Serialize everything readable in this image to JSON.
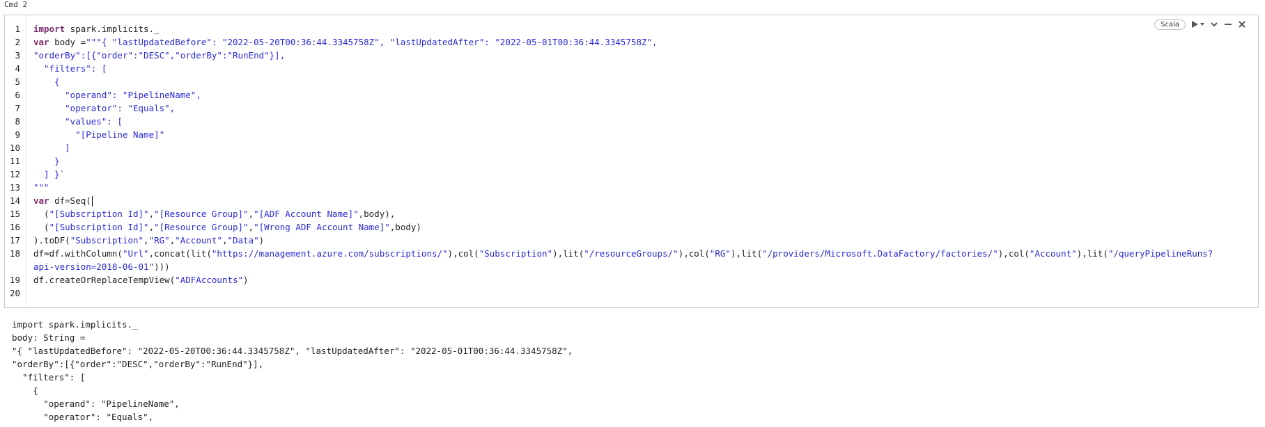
{
  "cmd_label": "Cmd 2",
  "toolbar": {
    "language": "Scala",
    "run_icon": "play-icon",
    "run_menu_icon": "caret-down-icon",
    "collapse_icon": "chevron-down-icon",
    "minimize_icon": "minus-icon",
    "close_icon": "close-icon"
  },
  "line_numbers": [
    "1",
    "2",
    "3",
    "4",
    "5",
    "6",
    "7",
    "8",
    "9",
    "10",
    "11",
    "12",
    "13",
    "14",
    "15",
    "16",
    "17",
    "18",
    "",
    "19",
    "20"
  ],
  "output_lines": [
    "import spark.implicits._",
    "body: String =",
    "\"{ \"lastUpdatedBefore\": \"2022-05-20T00:36:44.3345758Z\", \"lastUpdatedAfter\": \"2022-05-01T00:36:44.3345758Z\",",
    "\"orderBy\":[{\"order\":\"DESC\",\"orderBy\":\"RunEnd\"}],",
    "  \"filters\": [",
    "    {",
    "      \"operand\": \"PipelineName\",",
    "      \"operator\": \"Equals\","
  ],
  "colors": {
    "keyword": "#7b2c6b",
    "string": "#2a2ad6",
    "text": "#222222",
    "border": "#c9c9c9"
  }
}
